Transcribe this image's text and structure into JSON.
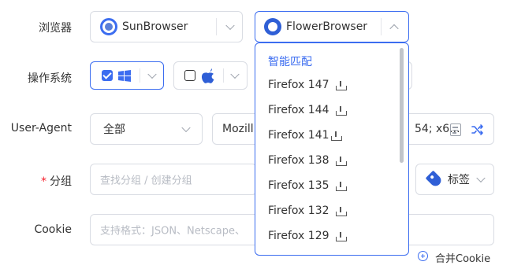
{
  "labels": {
    "browser": "浏览器",
    "os": "操作系统",
    "user_agent": "User-Agent",
    "required_mark": "*",
    "group": "分组",
    "cookie": "Cookie"
  },
  "browser_row": {
    "option_1": "SunBrowser",
    "option_2": "FlowerBrowser"
  },
  "os_row": {
    "windows_checked": true,
    "mac_checked": false
  },
  "user_agent_row": {
    "type_select": "全部",
    "value_left": "Mozill",
    "value_right": "54; x6..."
  },
  "group_row": {
    "placeholder": "查找分组 / 创建分组",
    "tag_label": "标签"
  },
  "cookie_row": {
    "placeholder": "支持格式：JSON、Netscape、"
  },
  "merge_cookie": "合并Cookie",
  "dropdown": {
    "smart_match": "智能匹配",
    "versions": [
      "Firefox 147",
      "Firefox 144",
      "Firefox 141",
      "Firefox 138",
      "Firefox 135",
      "Firefox 132",
      "Firefox 129"
    ]
  },
  "colors": {
    "accent": "#3c6df0",
    "required": "#f5222d",
    "border": "#d9dce3"
  }
}
